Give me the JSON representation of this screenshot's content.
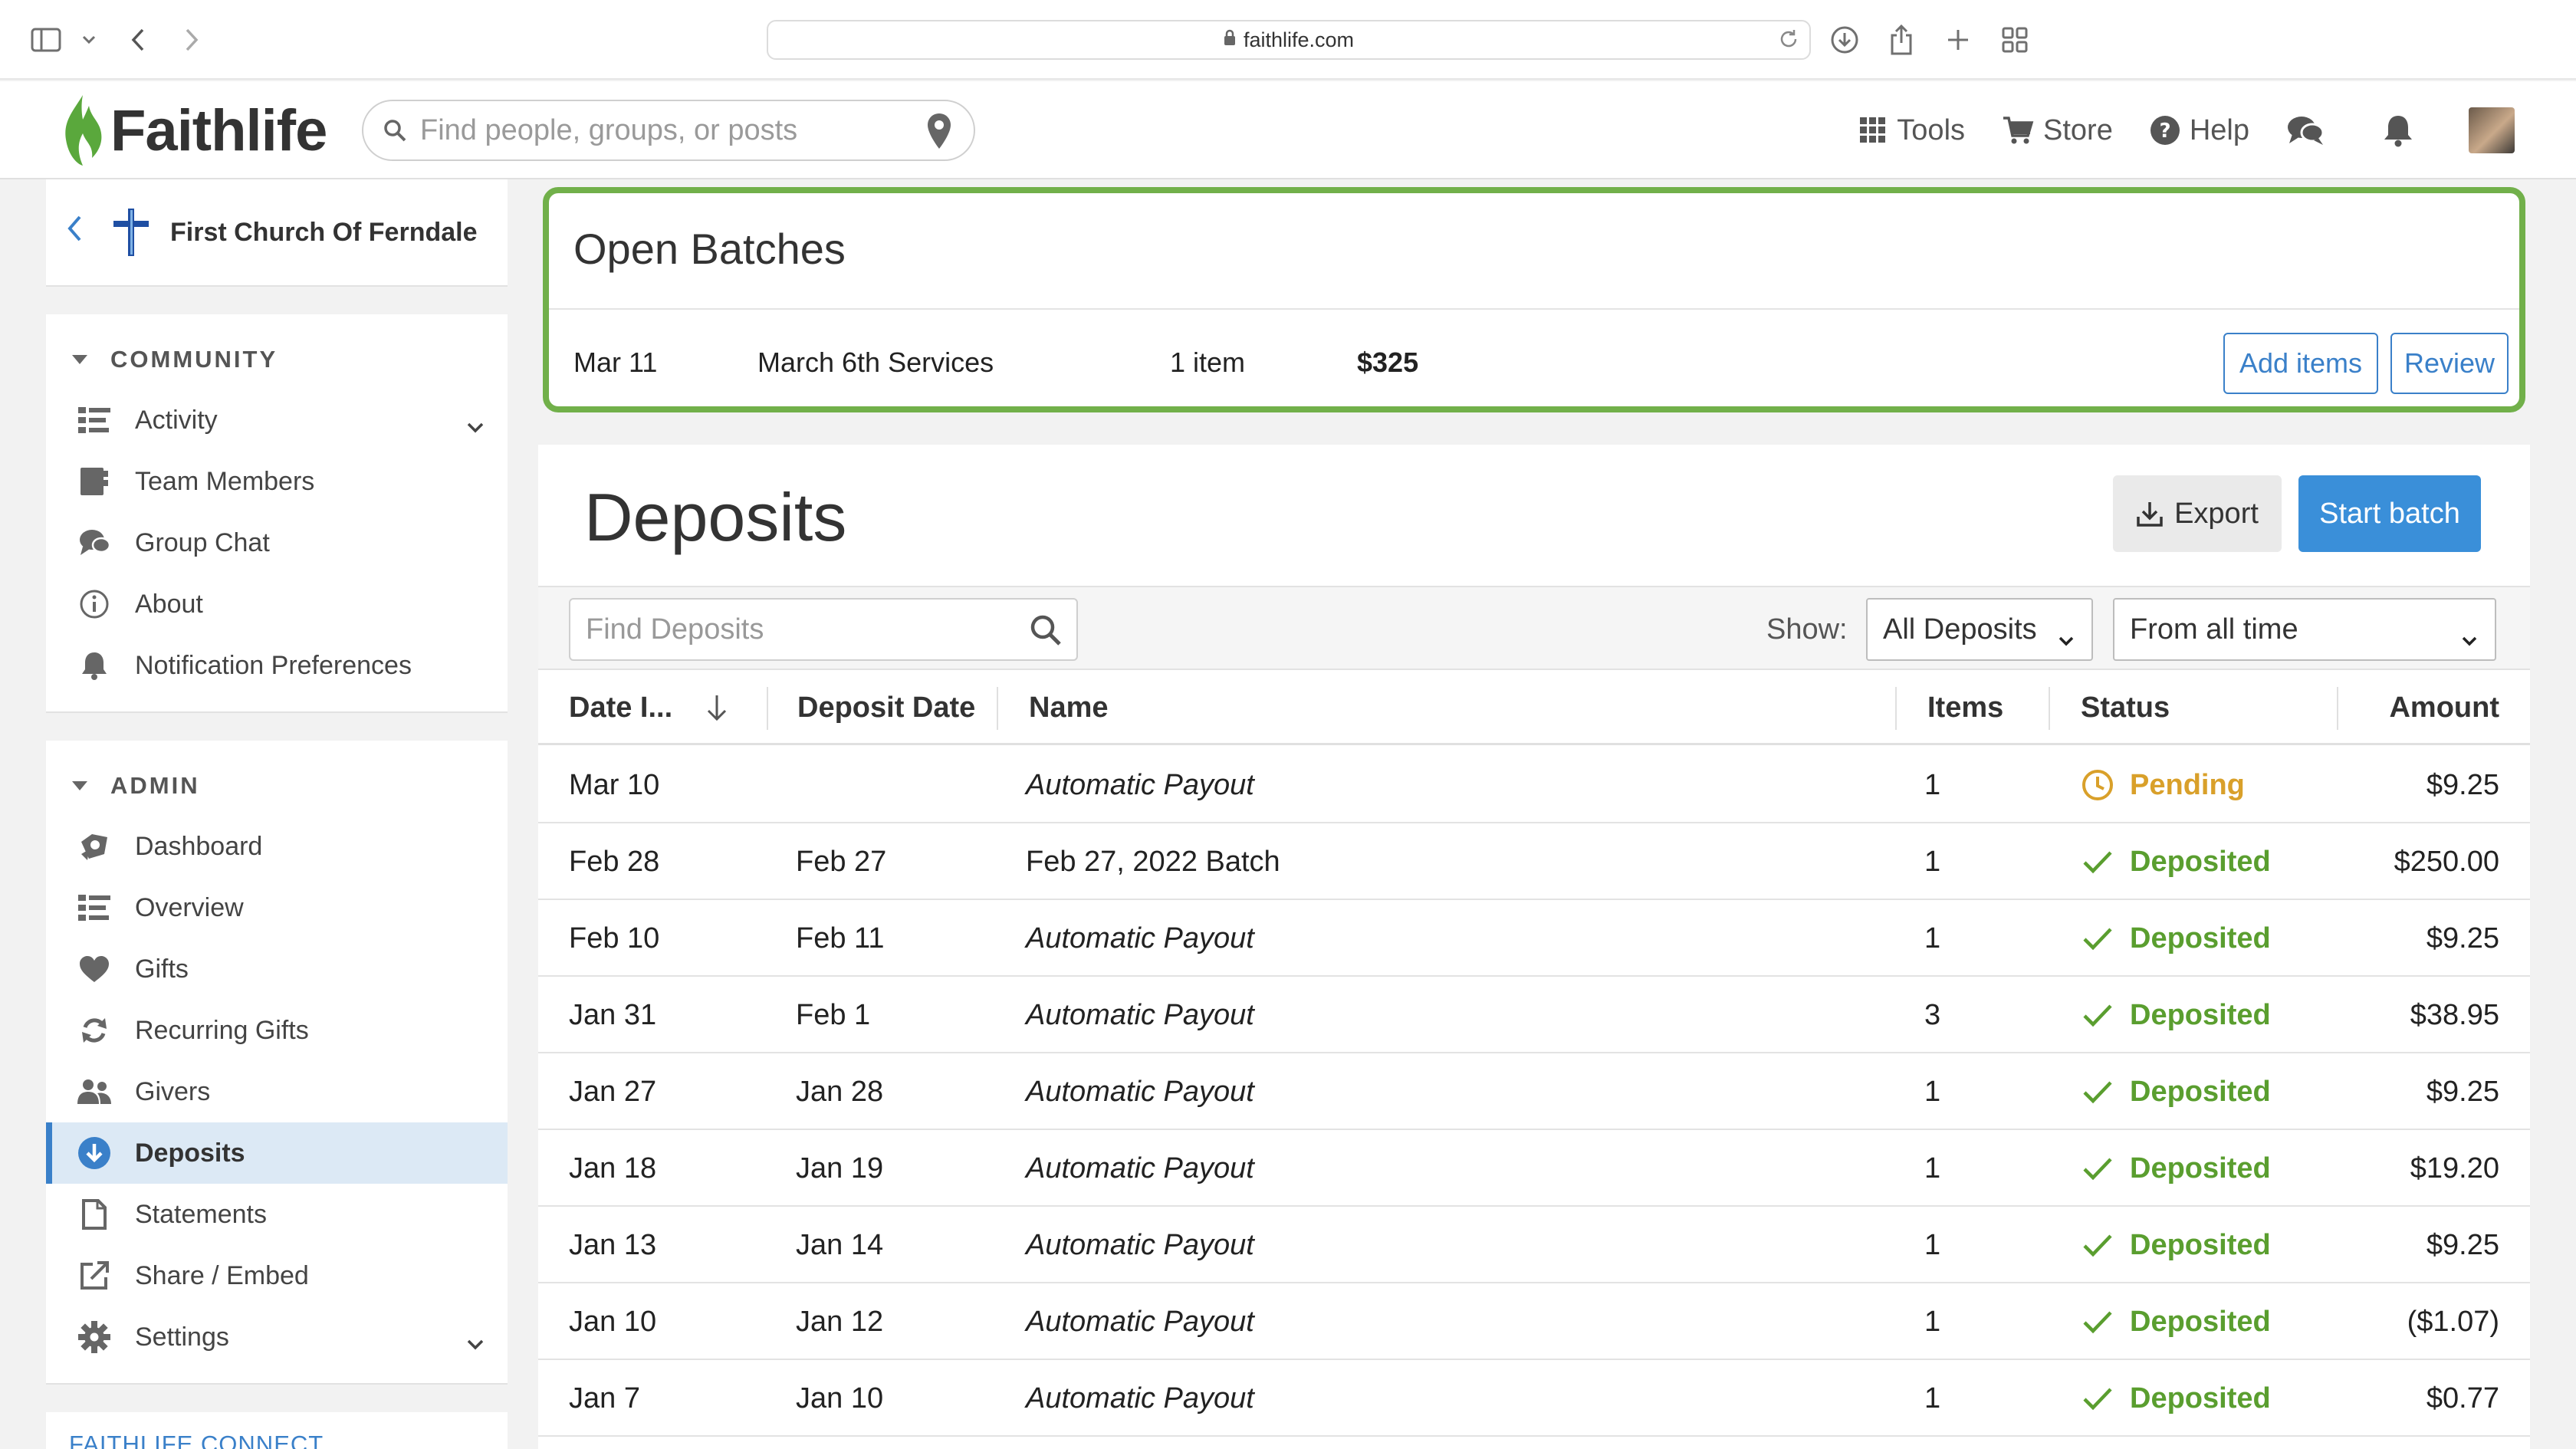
{
  "browser": {
    "url": "faithlife.com"
  },
  "header": {
    "logo_text": "Faithlife",
    "search_placeholder": "Find people, groups, or posts",
    "nav": {
      "tools": "Tools",
      "store": "Store",
      "help": "Help"
    }
  },
  "sidebar": {
    "org_name": "First Church Of Ferndale",
    "community_label": "COMMUNITY",
    "community_items": [
      {
        "label": "Activity",
        "icon": "activity-list-icon"
      },
      {
        "label": "Team Members",
        "icon": "team-icon"
      },
      {
        "label": "Group Chat",
        "icon": "chat-icon"
      },
      {
        "label": "About",
        "icon": "info-icon"
      },
      {
        "label": "Notification Preferences",
        "icon": "bell-icon"
      }
    ],
    "admin_label": "ADMIN",
    "admin_items": [
      {
        "label": "Dashboard",
        "icon": "dashboard-icon"
      },
      {
        "label": "Overview",
        "icon": "overview-list-icon"
      },
      {
        "label": "Gifts",
        "icon": "heart-icon"
      },
      {
        "label": "Recurring Gifts",
        "icon": "recurring-icon"
      },
      {
        "label": "Givers",
        "icon": "givers-icon"
      },
      {
        "label": "Deposits",
        "icon": "deposit-download-icon"
      },
      {
        "label": "Statements",
        "icon": "document-icon"
      },
      {
        "label": "Share / Embed",
        "icon": "share-icon"
      },
      {
        "label": "Settings",
        "icon": "gear-icon"
      }
    ],
    "connect_label": "FAITHLIFE CONNECT"
  },
  "open_batches": {
    "title": "Open Batches",
    "batch": {
      "date": "Mar 11",
      "name": "March 6th Services",
      "count": "1 item",
      "amount": "$325"
    },
    "add_items_label": "Add items",
    "review_label": "Review"
  },
  "deposits": {
    "title": "Deposits",
    "export_label": "Export",
    "start_batch_label": "Start batch",
    "find_placeholder": "Find Deposits",
    "show_label": "Show:",
    "show_value": "All Deposits",
    "range_value": "From all time",
    "columns": [
      "Date I...",
      "Deposit Date",
      "Name",
      "Items",
      "Status",
      "Amount"
    ],
    "colors": {
      "deposited": "#5a9e2f",
      "pending": "#d9a02a"
    },
    "rows": [
      {
        "date": "Mar 10",
        "deposit_date": "",
        "name": "Automatic Payout",
        "italic": true,
        "items": "1",
        "status": "Pending",
        "amount": "$9.25"
      },
      {
        "date": "Feb 28",
        "deposit_date": "Feb 27",
        "name": "Feb 27, 2022 Batch",
        "italic": false,
        "items": "1",
        "status": "Deposited",
        "amount": "$250.00"
      },
      {
        "date": "Feb 10",
        "deposit_date": "Feb 11",
        "name": "Automatic Payout",
        "italic": true,
        "items": "1",
        "status": "Deposited",
        "amount": "$9.25"
      },
      {
        "date": "Jan 31",
        "deposit_date": "Feb 1",
        "name": "Automatic Payout",
        "italic": true,
        "items": "3",
        "status": "Deposited",
        "amount": "$38.95"
      },
      {
        "date": "Jan 27",
        "deposit_date": "Jan 28",
        "name": "Automatic Payout",
        "italic": true,
        "items": "1",
        "status": "Deposited",
        "amount": "$9.25"
      },
      {
        "date": "Jan 18",
        "deposit_date": "Jan 19",
        "name": "Automatic Payout",
        "italic": true,
        "items": "1",
        "status": "Deposited",
        "amount": "$19.20"
      },
      {
        "date": "Jan 13",
        "deposit_date": "Jan 14",
        "name": "Automatic Payout",
        "italic": true,
        "items": "1",
        "status": "Deposited",
        "amount": "$9.25"
      },
      {
        "date": "Jan 10",
        "deposit_date": "Jan 12",
        "name": "Automatic Payout",
        "italic": true,
        "items": "1",
        "status": "Deposited",
        "amount": "($1.07)"
      },
      {
        "date": "Jan 7",
        "deposit_date": "Jan 10",
        "name": "Automatic Payout",
        "italic": true,
        "items": "1",
        "status": "Deposited",
        "amount": "$0.77"
      }
    ]
  }
}
